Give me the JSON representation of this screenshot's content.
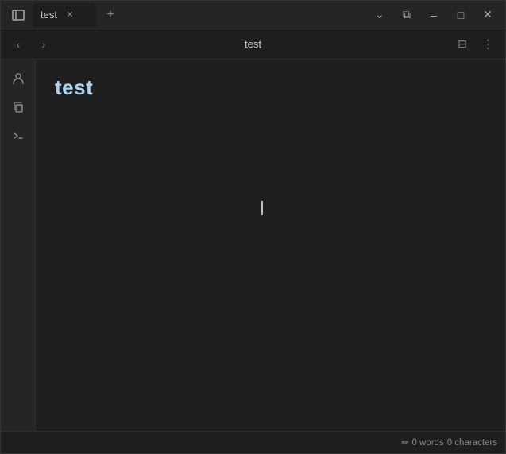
{
  "tab": {
    "label": "test",
    "close_label": "✕"
  },
  "new_tab_label": "+",
  "window_controls": {
    "chevron_label": "⌄",
    "split_label": "⧉",
    "minimize_label": "–",
    "maximize_label": "□",
    "close_label": "✕"
  },
  "toolbar": {
    "back_label": "‹",
    "forward_label": "›",
    "title": "test",
    "reader_label": "⊟",
    "menu_label": "⋮"
  },
  "sidebar": {
    "icons": [
      {
        "name": "user-icon",
        "symbol": "👤"
      },
      {
        "name": "copy-icon",
        "symbol": "⧉"
      },
      {
        "name": "terminal-icon",
        "symbol": ">_"
      }
    ]
  },
  "content": {
    "heading": "test"
  },
  "status_bar": {
    "words_label": "0 words",
    "chars_label": "0 characters",
    "edit_icon": "✏"
  }
}
